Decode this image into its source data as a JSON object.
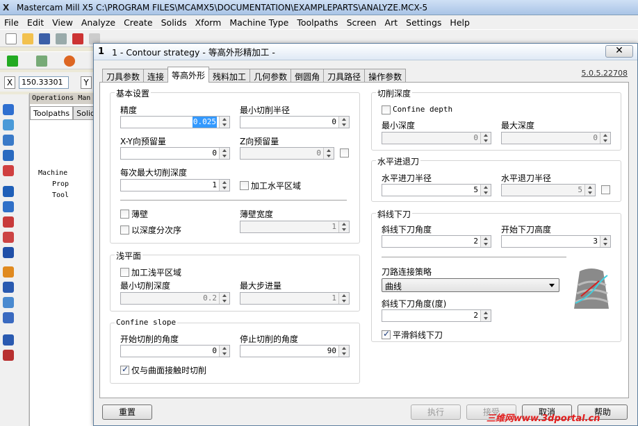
{
  "app": {
    "title": "Mastercam Mill X5  C:\\PROGRAM FILES\\MCAMX5\\DOCUMENTATION\\EXAMPLEPARTS\\ANALYZE.MCX-5",
    "logo": "X"
  },
  "menu": [
    "File",
    "Edit",
    "View",
    "Analyze",
    "Create",
    "Solids",
    "Xform",
    "Machine Type",
    "Toolpaths",
    "Screen",
    "Art",
    "Settings",
    "Help"
  ],
  "coords": {
    "x_label": "X",
    "x_value": "150.33301",
    "y_label": "Y"
  },
  "ops": {
    "header": "Operations Man",
    "tab_toolpaths": "Toolpaths",
    "tab_solids": "Solid",
    "tree": [
      "Machine",
      "Prop",
      "Tool"
    ]
  },
  "dialog": {
    "icon": "1",
    "title": "1 - Contour strategy - 等高外形精加工 -",
    "version": "5.0.5.22708",
    "tabs": [
      "刀具参数",
      "连接",
      "等高外形",
      "残料加工",
      "几何参数",
      "倒圆角",
      "刀具路径",
      "操作参数"
    ],
    "basic": {
      "title": "基本设置",
      "precision_label": "精度",
      "precision_value": "0.025",
      "min_radius_label": "最小切削半径",
      "min_radius_value": "0",
      "xy_stock_label": "X-Y向预留量",
      "xy_stock_value": "0",
      "z_stock_label": "Z向预留量",
      "z_stock_value": "0",
      "max_depth_label": "每次最大切削深度",
      "max_depth_value": "1",
      "flat_region_label": "加工水平区域",
      "thin_wall_label": "薄壁",
      "thin_width_label": "薄壁宽度",
      "thin_width_value": "1",
      "depth_order_label": "以深度分次序"
    },
    "shallow": {
      "title": "浅平面",
      "shallow_region_label": "加工浅平区域",
      "min_depth_label": "最小切削深度",
      "min_depth_value": "0.2",
      "max_step_label": "最大步进量",
      "max_step_value": "1"
    },
    "confine": {
      "title": "Confine slope",
      "start_angle_label": "开始切削的角度",
      "start_angle_value": "0",
      "stop_angle_label": "停止切削的角度",
      "stop_angle_value": "90",
      "contact_label": "仅与曲面接触时切削"
    },
    "cut_depth": {
      "title": "切削深度",
      "confine_depth_label": "Confine depth",
      "min_depth_label": "最小深度",
      "min_depth_value": "0",
      "max_depth_label": "最大深度",
      "max_depth_value": "0"
    },
    "horizontal": {
      "title": "水平进退刀",
      "entry_label": "水平进刀半径",
      "entry_value": "5",
      "exit_label": "水平退刀半径",
      "exit_value": "5"
    },
    "ramp": {
      "title": "斜线下刀",
      "angle_label": "斜线下刀角度",
      "angle_value": "2",
      "start_height_label": "开始下刀高度",
      "start_height_value": "3",
      "strategy_label": "刀路连接策略",
      "strategy_value": "曲线",
      "ramp_angle_deg_label": "斜线下刀角度(度)",
      "ramp_angle_deg_value": "2",
      "smooth_label": "平滑斜线下刀"
    },
    "buttons": {
      "reset": "重置",
      "execute": "执行",
      "apply": "接受",
      "cancel": "取消",
      "help": "帮助"
    }
  },
  "watermark": "三维网www.3dportal.cn",
  "colors": {
    "accent": "#3399ff",
    "watermark": "#e21d1d"
  }
}
